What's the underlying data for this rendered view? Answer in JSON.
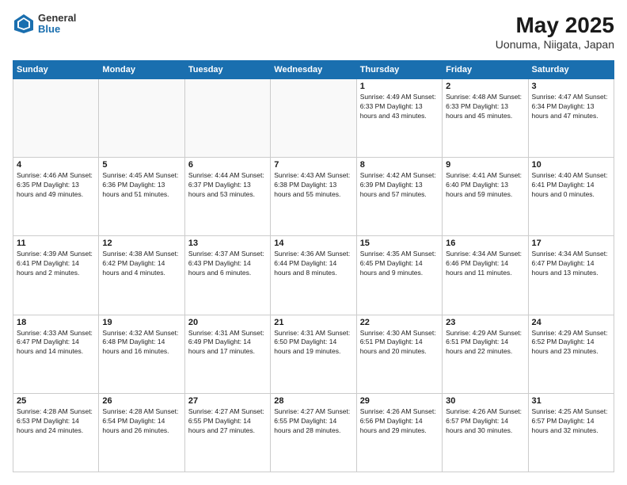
{
  "header": {
    "logo_general": "General",
    "logo_blue": "Blue",
    "month_title": "May 2025",
    "subtitle": "Uonuma, Niigata, Japan"
  },
  "weekdays": [
    "Sunday",
    "Monday",
    "Tuesday",
    "Wednesday",
    "Thursday",
    "Friday",
    "Saturday"
  ],
  "weeks": [
    [
      {
        "day": "",
        "info": ""
      },
      {
        "day": "",
        "info": ""
      },
      {
        "day": "",
        "info": ""
      },
      {
        "day": "",
        "info": ""
      },
      {
        "day": "1",
        "info": "Sunrise: 4:49 AM\nSunset: 6:33 PM\nDaylight: 13 hours\nand 43 minutes."
      },
      {
        "day": "2",
        "info": "Sunrise: 4:48 AM\nSunset: 6:33 PM\nDaylight: 13 hours\nand 45 minutes."
      },
      {
        "day": "3",
        "info": "Sunrise: 4:47 AM\nSunset: 6:34 PM\nDaylight: 13 hours\nand 47 minutes."
      }
    ],
    [
      {
        "day": "4",
        "info": "Sunrise: 4:46 AM\nSunset: 6:35 PM\nDaylight: 13 hours\nand 49 minutes."
      },
      {
        "day": "5",
        "info": "Sunrise: 4:45 AM\nSunset: 6:36 PM\nDaylight: 13 hours\nand 51 minutes."
      },
      {
        "day": "6",
        "info": "Sunrise: 4:44 AM\nSunset: 6:37 PM\nDaylight: 13 hours\nand 53 minutes."
      },
      {
        "day": "7",
        "info": "Sunrise: 4:43 AM\nSunset: 6:38 PM\nDaylight: 13 hours\nand 55 minutes."
      },
      {
        "day": "8",
        "info": "Sunrise: 4:42 AM\nSunset: 6:39 PM\nDaylight: 13 hours\nand 57 minutes."
      },
      {
        "day": "9",
        "info": "Sunrise: 4:41 AM\nSunset: 6:40 PM\nDaylight: 13 hours\nand 59 minutes."
      },
      {
        "day": "10",
        "info": "Sunrise: 4:40 AM\nSunset: 6:41 PM\nDaylight: 14 hours\nand 0 minutes."
      }
    ],
    [
      {
        "day": "11",
        "info": "Sunrise: 4:39 AM\nSunset: 6:41 PM\nDaylight: 14 hours\nand 2 minutes."
      },
      {
        "day": "12",
        "info": "Sunrise: 4:38 AM\nSunset: 6:42 PM\nDaylight: 14 hours\nand 4 minutes."
      },
      {
        "day": "13",
        "info": "Sunrise: 4:37 AM\nSunset: 6:43 PM\nDaylight: 14 hours\nand 6 minutes."
      },
      {
        "day": "14",
        "info": "Sunrise: 4:36 AM\nSunset: 6:44 PM\nDaylight: 14 hours\nand 8 minutes."
      },
      {
        "day": "15",
        "info": "Sunrise: 4:35 AM\nSunset: 6:45 PM\nDaylight: 14 hours\nand 9 minutes."
      },
      {
        "day": "16",
        "info": "Sunrise: 4:34 AM\nSunset: 6:46 PM\nDaylight: 14 hours\nand 11 minutes."
      },
      {
        "day": "17",
        "info": "Sunrise: 4:34 AM\nSunset: 6:47 PM\nDaylight: 14 hours\nand 13 minutes."
      }
    ],
    [
      {
        "day": "18",
        "info": "Sunrise: 4:33 AM\nSunset: 6:47 PM\nDaylight: 14 hours\nand 14 minutes."
      },
      {
        "day": "19",
        "info": "Sunrise: 4:32 AM\nSunset: 6:48 PM\nDaylight: 14 hours\nand 16 minutes."
      },
      {
        "day": "20",
        "info": "Sunrise: 4:31 AM\nSunset: 6:49 PM\nDaylight: 14 hours\nand 17 minutes."
      },
      {
        "day": "21",
        "info": "Sunrise: 4:31 AM\nSunset: 6:50 PM\nDaylight: 14 hours\nand 19 minutes."
      },
      {
        "day": "22",
        "info": "Sunrise: 4:30 AM\nSunset: 6:51 PM\nDaylight: 14 hours\nand 20 minutes."
      },
      {
        "day": "23",
        "info": "Sunrise: 4:29 AM\nSunset: 6:51 PM\nDaylight: 14 hours\nand 22 minutes."
      },
      {
        "day": "24",
        "info": "Sunrise: 4:29 AM\nSunset: 6:52 PM\nDaylight: 14 hours\nand 23 minutes."
      }
    ],
    [
      {
        "day": "25",
        "info": "Sunrise: 4:28 AM\nSunset: 6:53 PM\nDaylight: 14 hours\nand 24 minutes."
      },
      {
        "day": "26",
        "info": "Sunrise: 4:28 AM\nSunset: 6:54 PM\nDaylight: 14 hours\nand 26 minutes."
      },
      {
        "day": "27",
        "info": "Sunrise: 4:27 AM\nSunset: 6:55 PM\nDaylight: 14 hours\nand 27 minutes."
      },
      {
        "day": "28",
        "info": "Sunrise: 4:27 AM\nSunset: 6:55 PM\nDaylight: 14 hours\nand 28 minutes."
      },
      {
        "day": "29",
        "info": "Sunrise: 4:26 AM\nSunset: 6:56 PM\nDaylight: 14 hours\nand 29 minutes."
      },
      {
        "day": "30",
        "info": "Sunrise: 4:26 AM\nSunset: 6:57 PM\nDaylight: 14 hours\nand 30 minutes."
      },
      {
        "day": "31",
        "info": "Sunrise: 4:25 AM\nSunset: 6:57 PM\nDaylight: 14 hours\nand 32 minutes."
      }
    ]
  ]
}
